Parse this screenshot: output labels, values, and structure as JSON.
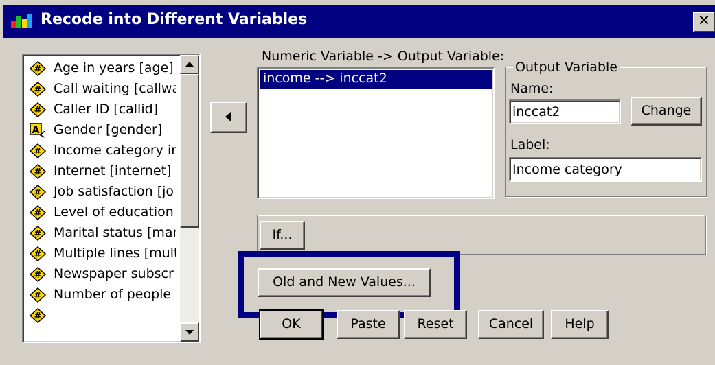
{
  "window": {
    "title": "Recode into Different Variables",
    "close_glyph": "✕"
  },
  "variables": [
    {
      "label": "Age in years [age]",
      "icon": "numeric-icon"
    },
    {
      "label": "Call waiting [callwa",
      "icon": "numeric-icon"
    },
    {
      "label": "Caller ID [callid]",
      "icon": "numeric-icon"
    },
    {
      "label": "Gender [gender]",
      "icon": "string-icon"
    },
    {
      "label": "Income category ir",
      "icon": "numeric-icon"
    },
    {
      "label": "Internet [internet]",
      "icon": "numeric-icon"
    },
    {
      "label": "Job satisfaction [jo",
      "icon": "numeric-icon"
    },
    {
      "label": "Level of education",
      "icon": "numeric-icon"
    },
    {
      "label": "Marital status [mari",
      "icon": "numeric-icon"
    },
    {
      "label": "Multiple lines [multl",
      "icon": "numeric-icon"
    },
    {
      "label": "Newspaper subscr",
      "icon": "numeric-icon"
    },
    {
      "label": "Number of people",
      "icon": "numeric-icon"
    },
    {
      "label": "",
      "icon": "numeric-icon"
    }
  ],
  "mapping": {
    "header": "Numeric Variable -> Output Variable:",
    "items": [
      "income --> inccat2"
    ]
  },
  "output": {
    "group_label": "Output Variable",
    "name_label": "Name:",
    "name_value": "inccat2",
    "change_label": "Change",
    "label_label": "Label:",
    "label_value": "Income category"
  },
  "buttons": {
    "if": "If...",
    "old_new": "Old and New Values...",
    "ok": "OK",
    "paste": "Paste",
    "reset": "Reset",
    "cancel": "Cancel",
    "help": "Help"
  },
  "colors": {
    "title_bar": "#000080",
    "selection": "#000080",
    "highlight_box": "#000080",
    "face": "#d4d0c8"
  }
}
